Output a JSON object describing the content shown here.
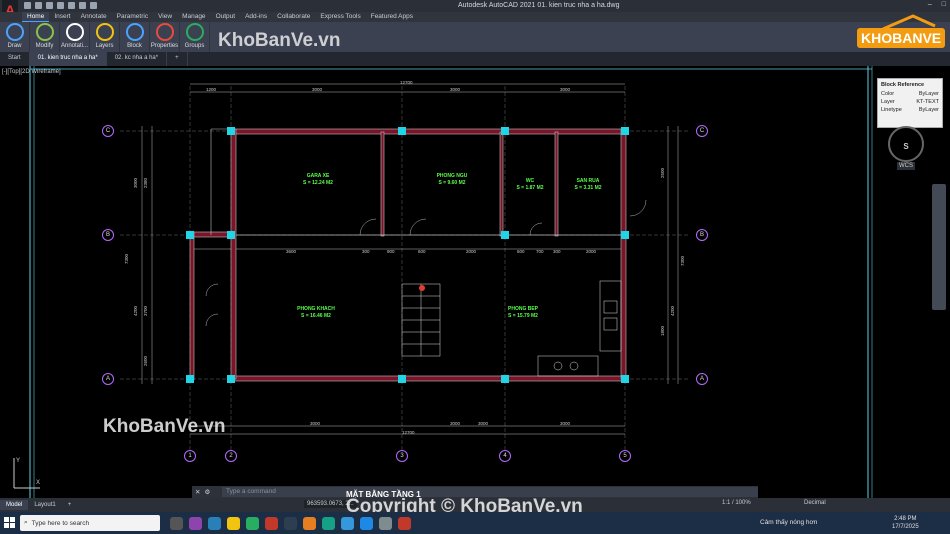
{
  "app": {
    "title": "Autodesk AutoCAD 2021   01. kien truc nha a ha.dwg",
    "logo_letter": "A"
  },
  "ribbon": {
    "tabs": [
      {
        "label": "Home",
        "active": true
      },
      {
        "label": "Insert"
      },
      {
        "label": "Annotate"
      },
      {
        "label": "Parametric"
      },
      {
        "label": "View"
      },
      {
        "label": "Manage"
      },
      {
        "label": "Output"
      },
      {
        "label": "Add-ins"
      },
      {
        "label": "Collaborate"
      },
      {
        "label": "Express Tools"
      },
      {
        "label": "Featured Apps"
      }
    ],
    "panels": [
      {
        "label": "Draw",
        "icon": "draw-icon",
        "color": "#4aa3ff"
      },
      {
        "label": "Modify",
        "icon": "modify-icon",
        "color": "#8bc34a"
      },
      {
        "label": "Annotati...",
        "icon": "text-icon",
        "color": "#ffffff"
      },
      {
        "label": "Layers",
        "icon": "layers-icon",
        "color": "#f1c40f"
      },
      {
        "label": "Block",
        "icon": "block-icon",
        "color": "#4aa3ff"
      },
      {
        "label": "Properties",
        "icon": "properties-icon",
        "color": "#e74c3c"
      },
      {
        "label": "Groups",
        "icon": "groups-icon",
        "color": "#27ae60"
      }
    ]
  },
  "doc_tabs": [
    {
      "label": "Start"
    },
    {
      "label": "01. kien truc nha a ha*",
      "active": true
    },
    {
      "label": "02. kc nha a ha*"
    },
    {
      "label": "+"
    }
  ],
  "viewport": {
    "label": "[-][Top][2D Wireframe]"
  },
  "block_reference": {
    "heading": "Block Reference",
    "rows": [
      {
        "key": "Color",
        "value": "ByLayer"
      },
      {
        "key": "Layer",
        "value": "KT-TEXT"
      },
      {
        "key": "Linetype",
        "value": "ByLayer"
      }
    ]
  },
  "viewcube": {
    "direction": "S",
    "wcs_label": "WCS"
  },
  "drawing": {
    "sheet_title": "MẶT BẰNG TẦNG 1",
    "rooms": [
      {
        "name": "GARA XE",
        "area": "S = 12.24 M2"
      },
      {
        "name": "PHONG NGU",
        "area": "S = 9.60 M2"
      },
      {
        "name": "WC",
        "area": "S = 1.87 M2"
      },
      {
        "name": "SAN RUA",
        "area": "S = 3.31 M2"
      },
      {
        "name": "PHONG KHACH",
        "area": "S = 16.46 M2"
      },
      {
        "name": "PHONG BEP",
        "area": "S = 15.79 M2"
      }
    ],
    "grid_rows": [
      "C",
      "B",
      "A"
    ],
    "grid_cols": [
      "1",
      "2",
      "3",
      "4",
      "5"
    ],
    "top_dims": [
      "1200",
      "3000",
      "3000",
      "3000"
    ],
    "top_total": "12700",
    "mid_dims": [
      "3600",
      "300",
      "900",
      "600",
      "2000",
      "600",
      "700",
      "300",
      "2000"
    ],
    "bottom_dims": [
      "3000",
      "3000",
      "3000",
      "3000"
    ],
    "bottom_total": "12700",
    "left_dims": [
      "3000",
      "2380",
      "4200",
      "3700",
      "2600",
      "7300"
    ],
    "right_dims": [
      "2500",
      "7300",
      "4200",
      "1800"
    ]
  },
  "command": {
    "placeholder": "Type a command"
  },
  "model_tabs": [
    {
      "label": "Model",
      "active": true
    },
    {
      "label": "Layout1"
    },
    {
      "label": "+"
    }
  ],
  "status": {
    "coords": "963593.0673, 2...",
    "scale": "1:1 / 100%",
    "units": "Decimal"
  },
  "taskbar": {
    "search_placeholder": "Type here to search",
    "weather": "Cảm thấy nóng hơn",
    "time": "2:48 PM",
    "date": "17/7/2025"
  },
  "watermarks": {
    "top": "KhoBanVe.vn",
    "left": "KhoBanVe.vn",
    "bottom": "Copyright © KhoBanVe.vn",
    "logo": "KHOBANVE"
  }
}
